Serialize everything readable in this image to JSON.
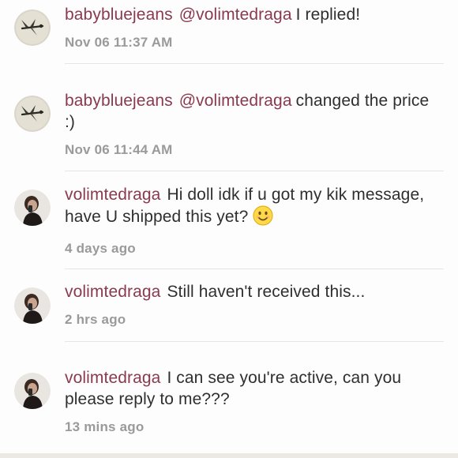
{
  "comments": [
    {
      "username": "babybluejeans",
      "mention": "@volimtedraga",
      "message": "I replied!",
      "timestamp": "Nov 06 11:37 AM",
      "avatar_icon": "dragonfly-avatar-icon"
    },
    {
      "username": "babybluejeans",
      "mention": "@volimtedraga",
      "message": "changed the price :)",
      "timestamp": "Nov 06 11:44 AM",
      "avatar_icon": "dragonfly-avatar-icon"
    },
    {
      "username": "volimtedraga",
      "message": "Hi doll idk if u got my kik message, have U shipped this yet?",
      "timestamp": "4 days ago",
      "avatar_icon": "person-avatar-icon",
      "emoji": "smiling-face-emoji"
    },
    {
      "username": "volimtedraga",
      "message": "Still haven't received this...",
      "timestamp": "2 hrs ago",
      "avatar_icon": "person-avatar-icon"
    },
    {
      "username": "volimtedraga",
      "message": "I can see you're active, can you please reply to me???",
      "timestamp": "13 mins ago",
      "avatar_icon": "person-avatar-icon"
    }
  ],
  "colors": {
    "username": "#8a3a4f",
    "message": "#2f2f2f",
    "timestamp": "#9a9a9a",
    "divider": "#e6e6e6"
  }
}
